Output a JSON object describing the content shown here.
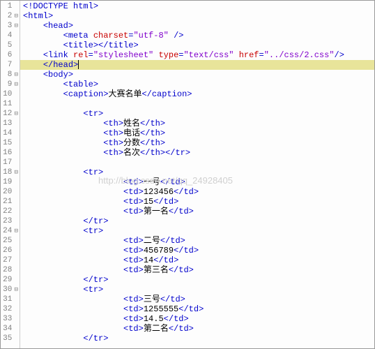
{
  "watermark": "http://blog.csdn.net/qq_24928405",
  "lines": [
    {
      "n": 1,
      "fold": "",
      "indent": 0,
      "tokens": [
        [
          "punct",
          "<!"
        ],
        [
          "tag",
          "DOCTYPE html"
        ],
        [
          "punct",
          ">"
        ]
      ]
    },
    {
      "n": 2,
      "fold": "⊟",
      "indent": 0,
      "tokens": [
        [
          "punct",
          "<"
        ],
        [
          "tag",
          "html"
        ],
        [
          "punct",
          ">"
        ]
      ]
    },
    {
      "n": 3,
      "fold": "⊟",
      "indent": 1,
      "tokens": [
        [
          "punct",
          "<"
        ],
        [
          "tag",
          "head"
        ],
        [
          "punct",
          ">"
        ]
      ]
    },
    {
      "n": 4,
      "fold": "",
      "indent": 2,
      "tokens": [
        [
          "punct",
          "<"
        ],
        [
          "tag",
          "meta "
        ],
        [
          "attr-name",
          "charset"
        ],
        [
          "punct",
          "="
        ],
        [
          "attr-val",
          "\"utf-8\""
        ],
        [
          "punct",
          " />"
        ]
      ]
    },
    {
      "n": 5,
      "fold": "",
      "indent": 2,
      "tokens": [
        [
          "punct",
          "<"
        ],
        [
          "tag",
          "title"
        ],
        [
          "punct",
          ">"
        ],
        [
          "punct",
          "</"
        ],
        [
          "tag",
          "title"
        ],
        [
          "punct",
          ">"
        ]
      ]
    },
    {
      "n": 6,
      "fold": "",
      "indent": 1,
      "tokens": [
        [
          "punct",
          "<"
        ],
        [
          "tag",
          "link "
        ],
        [
          "attr-name",
          "rel"
        ],
        [
          "punct",
          "="
        ],
        [
          "attr-val",
          "\"stylesheet\""
        ],
        [
          "tag",
          " "
        ],
        [
          "attr-name",
          "type"
        ],
        [
          "punct",
          "="
        ],
        [
          "attr-val",
          "\"text/css\""
        ],
        [
          "tag",
          " "
        ],
        [
          "attr-name",
          "href"
        ],
        [
          "punct",
          "="
        ],
        [
          "attr-val",
          "\"../css/2.css\""
        ],
        [
          "punct",
          "/>"
        ]
      ]
    },
    {
      "n": 7,
      "fold": "",
      "indent": 1,
      "hl": true,
      "cursor": true,
      "tokens": [
        [
          "punct",
          "</"
        ],
        [
          "tag",
          "head"
        ],
        [
          "punct",
          ">"
        ]
      ]
    },
    {
      "n": 8,
      "fold": "⊟",
      "indent": 1,
      "tokens": [
        [
          "punct",
          "<"
        ],
        [
          "tag",
          "body"
        ],
        [
          "punct",
          ">"
        ]
      ]
    },
    {
      "n": 9,
      "fold": "⊟",
      "indent": 2,
      "tokens": [
        [
          "punct",
          "<"
        ],
        [
          "tag",
          "table"
        ],
        [
          "punct",
          ">"
        ]
      ]
    },
    {
      "n": 10,
      "fold": "",
      "indent": 2,
      "tokens": [
        [
          "punct",
          "<"
        ],
        [
          "tag",
          "caption"
        ],
        [
          "punct",
          ">"
        ],
        [
          "text",
          "大赛名单"
        ],
        [
          "punct",
          "</"
        ],
        [
          "tag",
          "caption"
        ],
        [
          "punct",
          ">"
        ]
      ]
    },
    {
      "n": 11,
      "fold": "",
      "indent": 2,
      "tokens": []
    },
    {
      "n": 12,
      "fold": "⊟",
      "indent": 3,
      "tokens": [
        [
          "punct",
          "<"
        ],
        [
          "tag",
          "tr"
        ],
        [
          "punct",
          ">"
        ]
      ]
    },
    {
      "n": 13,
      "fold": "",
      "indent": 4,
      "tokens": [
        [
          "punct",
          "<"
        ],
        [
          "tag",
          "th"
        ],
        [
          "punct",
          ">"
        ],
        [
          "text",
          "姓名"
        ],
        [
          "punct",
          "</"
        ],
        [
          "tag",
          "th"
        ],
        [
          "punct",
          ">"
        ]
      ]
    },
    {
      "n": 14,
      "fold": "",
      "indent": 4,
      "tokens": [
        [
          "punct",
          "<"
        ],
        [
          "tag",
          "th"
        ],
        [
          "punct",
          ">"
        ],
        [
          "text",
          "电话"
        ],
        [
          "punct",
          "</"
        ],
        [
          "tag",
          "th"
        ],
        [
          "punct",
          ">"
        ]
      ]
    },
    {
      "n": 15,
      "fold": "",
      "indent": 4,
      "tokens": [
        [
          "punct",
          "<"
        ],
        [
          "tag",
          "th"
        ],
        [
          "punct",
          ">"
        ],
        [
          "text",
          "分数"
        ],
        [
          "punct",
          "</"
        ],
        [
          "tag",
          "th"
        ],
        [
          "punct",
          ">"
        ]
      ]
    },
    {
      "n": 16,
      "fold": "",
      "indent": 4,
      "tokens": [
        [
          "punct",
          "<"
        ],
        [
          "tag",
          "th"
        ],
        [
          "punct",
          ">"
        ],
        [
          "text",
          "名次"
        ],
        [
          "punct",
          "</"
        ],
        [
          "tag",
          "th"
        ],
        [
          "punct",
          ">"
        ],
        [
          "punct",
          "</"
        ],
        [
          "tag",
          "tr"
        ],
        [
          "punct",
          ">"
        ]
      ]
    },
    {
      "n": 17,
      "fold": "",
      "indent": 2,
      "tokens": []
    },
    {
      "n": 18,
      "fold": "⊟",
      "indent": 3,
      "tokens": [
        [
          "punct",
          "<"
        ],
        [
          "tag",
          "tr"
        ],
        [
          "punct",
          ">"
        ]
      ]
    },
    {
      "n": 19,
      "fold": "",
      "indent": 5,
      "tokens": [
        [
          "punct",
          "<"
        ],
        [
          "tag",
          "td"
        ],
        [
          "punct",
          ">"
        ],
        [
          "text",
          "一号"
        ],
        [
          "punct",
          "</"
        ],
        [
          "tag",
          "td"
        ],
        [
          "punct",
          ">"
        ]
      ]
    },
    {
      "n": 20,
      "fold": "",
      "indent": 5,
      "tokens": [
        [
          "punct",
          "<"
        ],
        [
          "tag",
          "td"
        ],
        [
          "punct",
          ">"
        ],
        [
          "text",
          "123456"
        ],
        [
          "punct",
          "</"
        ],
        [
          "tag",
          "td"
        ],
        [
          "punct",
          ">"
        ]
      ]
    },
    {
      "n": 21,
      "fold": "",
      "indent": 5,
      "tokens": [
        [
          "punct",
          "<"
        ],
        [
          "tag",
          "td"
        ],
        [
          "punct",
          ">"
        ],
        [
          "text",
          "15"
        ],
        [
          "punct",
          "</"
        ],
        [
          "tag",
          "td"
        ],
        [
          "punct",
          ">"
        ]
      ]
    },
    {
      "n": 22,
      "fold": "",
      "indent": 5,
      "tokens": [
        [
          "punct",
          "<"
        ],
        [
          "tag",
          "td"
        ],
        [
          "punct",
          ">"
        ],
        [
          "text",
          "第一名"
        ],
        [
          "punct",
          "</"
        ],
        [
          "tag",
          "td"
        ],
        [
          "punct",
          ">"
        ]
      ]
    },
    {
      "n": 23,
      "fold": "",
      "indent": 3,
      "tokens": [
        [
          "punct",
          "</"
        ],
        [
          "tag",
          "tr"
        ],
        [
          "punct",
          ">"
        ]
      ]
    },
    {
      "n": 24,
      "fold": "⊟",
      "indent": 3,
      "tokens": [
        [
          "punct",
          "<"
        ],
        [
          "tag",
          "tr"
        ],
        [
          "punct",
          ">"
        ]
      ]
    },
    {
      "n": 25,
      "fold": "",
      "indent": 5,
      "tokens": [
        [
          "punct",
          "<"
        ],
        [
          "tag",
          "td"
        ],
        [
          "punct",
          ">"
        ],
        [
          "text",
          "二号"
        ],
        [
          "punct",
          "</"
        ],
        [
          "tag",
          "td"
        ],
        [
          "punct",
          ">"
        ]
      ]
    },
    {
      "n": 26,
      "fold": "",
      "indent": 5,
      "tokens": [
        [
          "punct",
          "<"
        ],
        [
          "tag",
          "td"
        ],
        [
          "punct",
          ">"
        ],
        [
          "text",
          "456789"
        ],
        [
          "punct",
          "</"
        ],
        [
          "tag",
          "td"
        ],
        [
          "punct",
          ">"
        ]
      ]
    },
    {
      "n": 27,
      "fold": "",
      "indent": 5,
      "tokens": [
        [
          "punct",
          "<"
        ],
        [
          "tag",
          "td"
        ],
        [
          "punct",
          ">"
        ],
        [
          "text",
          "14"
        ],
        [
          "punct",
          "</"
        ],
        [
          "tag",
          "td"
        ],
        [
          "punct",
          ">"
        ]
      ]
    },
    {
      "n": 28,
      "fold": "",
      "indent": 5,
      "tokens": [
        [
          "punct",
          "<"
        ],
        [
          "tag",
          "td"
        ],
        [
          "punct",
          ">"
        ],
        [
          "text",
          "第三名"
        ],
        [
          "punct",
          "</"
        ],
        [
          "tag",
          "td"
        ],
        [
          "punct",
          ">"
        ]
      ]
    },
    {
      "n": 29,
      "fold": "",
      "indent": 3,
      "tokens": [
        [
          "punct",
          "</"
        ],
        [
          "tag",
          "tr"
        ],
        [
          "punct",
          ">"
        ]
      ]
    },
    {
      "n": 30,
      "fold": "⊟",
      "indent": 3,
      "tokens": [
        [
          "punct",
          "<"
        ],
        [
          "tag",
          "tr"
        ],
        [
          "punct",
          ">"
        ]
      ]
    },
    {
      "n": 31,
      "fold": "",
      "indent": 5,
      "tokens": [
        [
          "punct",
          "<"
        ],
        [
          "tag",
          "td"
        ],
        [
          "punct",
          ">"
        ],
        [
          "text",
          "三号"
        ],
        [
          "punct",
          "</"
        ],
        [
          "tag",
          "td"
        ],
        [
          "punct",
          ">"
        ]
      ]
    },
    {
      "n": 32,
      "fold": "",
      "indent": 5,
      "tokens": [
        [
          "punct",
          "<"
        ],
        [
          "tag",
          "td"
        ],
        [
          "punct",
          ">"
        ],
        [
          "text",
          "1255555"
        ],
        [
          "punct",
          "</"
        ],
        [
          "tag",
          "td"
        ],
        [
          "punct",
          ">"
        ]
      ]
    },
    {
      "n": 33,
      "fold": "",
      "indent": 5,
      "tokens": [
        [
          "punct",
          "<"
        ],
        [
          "tag",
          "td"
        ],
        [
          "punct",
          ">"
        ],
        [
          "text",
          "14.5"
        ],
        [
          "punct",
          "</"
        ],
        [
          "tag",
          "td"
        ],
        [
          "punct",
          ">"
        ]
      ]
    },
    {
      "n": 34,
      "fold": "",
      "indent": 5,
      "tokens": [
        [
          "punct",
          "<"
        ],
        [
          "tag",
          "td"
        ],
        [
          "punct",
          ">"
        ],
        [
          "text",
          "第二名"
        ],
        [
          "punct",
          "</"
        ],
        [
          "tag",
          "td"
        ],
        [
          "punct",
          ">"
        ]
      ]
    },
    {
      "n": 35,
      "fold": "",
      "indent": 3,
      "tokens": [
        [
          "punct",
          "</"
        ],
        [
          "tag",
          "tr"
        ],
        [
          "punct",
          ">"
        ]
      ]
    }
  ]
}
